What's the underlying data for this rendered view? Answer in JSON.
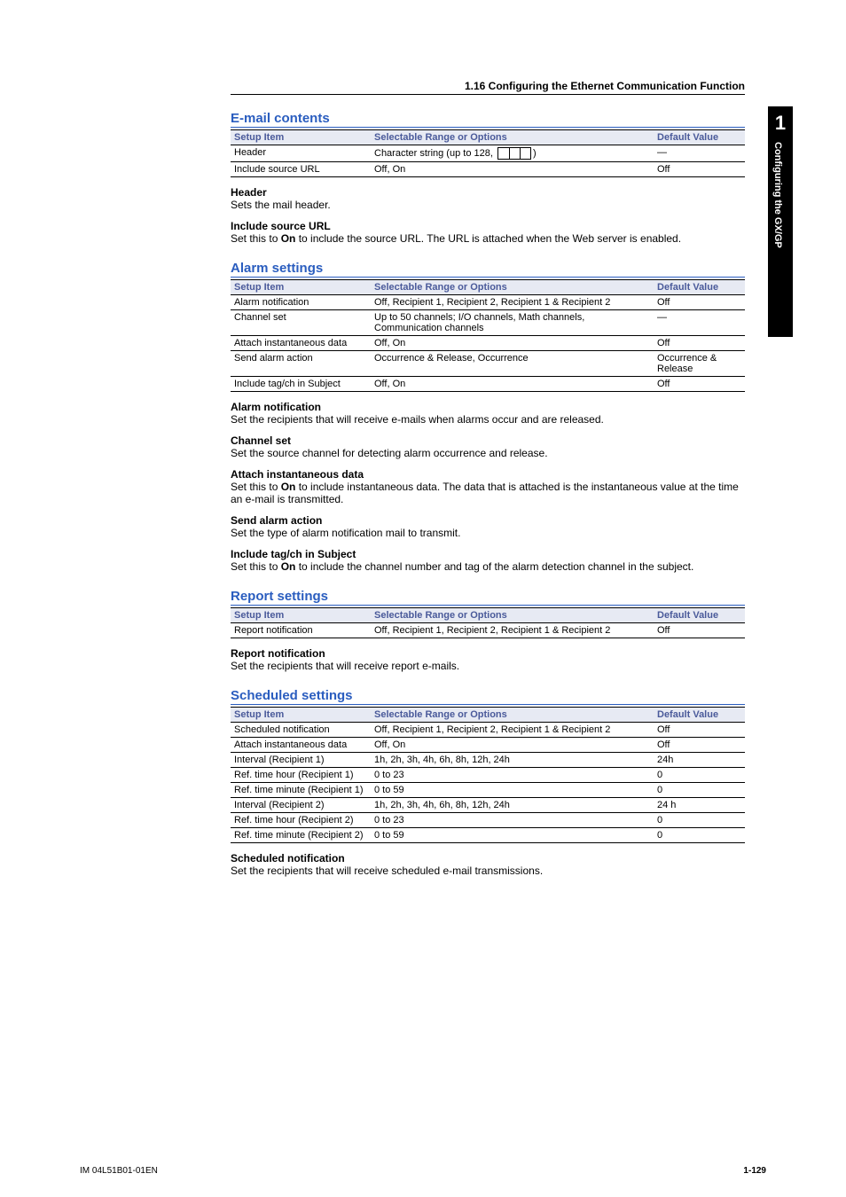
{
  "breadcrumb": "1.16  Configuring the Ethernet Communication Function",
  "sideTab": {
    "num": "1",
    "label": "Configuring the GX/GP"
  },
  "footer": {
    "left": "IM 04L51B01-01EN",
    "right": "1-129"
  },
  "email": {
    "title": "E-mail contents",
    "table": {
      "h1": "Setup Item",
      "h2": "Selectable Range or Options",
      "h3": "Default Value",
      "rows": [
        {
          "c1": "Header",
          "c2_prefix": "Character string (up to 128, ",
          "c2_suffix": ")",
          "c3": "―",
          "hasBox": true
        },
        {
          "c1": "Include source URL",
          "c2": "Off, On",
          "c3": "Off"
        }
      ]
    },
    "desc": [
      {
        "head": "Header",
        "body": "Sets the mail header."
      },
      {
        "head": "Include source URL",
        "body_pre": "Set this to ",
        "body_bold": "On",
        "body_post": " to include the source URL. The URL is attached when the Web server is enabled."
      }
    ]
  },
  "alarm": {
    "title": "Alarm settings",
    "table": {
      "h1": "Setup Item",
      "h2": "Selectable Range or Options",
      "h3": "Default Value",
      "rows": [
        {
          "c1": "Alarm notification",
          "c2": "Off, Recipient 1, Recipient 2, Recipient 1 & Recipient 2",
          "c3": "Off"
        },
        {
          "c1": "Channel set",
          "c2": "Up to 50 channels; I/O channels, Math channels, Communication channels",
          "c3": "―"
        },
        {
          "c1": "Attach instantaneous data",
          "c2": "Off, On",
          "c3": "Off"
        },
        {
          "c1": "Send alarm action",
          "c2": "Occurrence & Release, Occurrence",
          "c3": "Occurrence & Release"
        },
        {
          "c1": "Include tag/ch in Subject",
          "c2": "Off, On",
          "c3": "Off"
        }
      ]
    },
    "desc": [
      {
        "head": "Alarm notification",
        "body": "Set the recipients that will receive e-mails when alarms occur and are released."
      },
      {
        "head": "Channel set",
        "body": "Set the source channel for detecting alarm occurrence and release."
      },
      {
        "head": "Attach instantaneous data",
        "body_pre": "Set this to ",
        "body_bold": "On",
        "body_post": " to include instantaneous data. The data that is attached is the instantaneous value at the time an e-mail is transmitted."
      },
      {
        "head": "Send alarm action",
        "body": "Set the type of alarm notification mail to transmit."
      },
      {
        "head": "Include tag/ch in Subject",
        "body_pre": "Set this to ",
        "body_bold": "On",
        "body_post": " to include the channel number and tag of the alarm detection channel in the subject."
      }
    ]
  },
  "report": {
    "title": "Report settings",
    "table": {
      "h1": "Setup Item",
      "h2": "Selectable Range or Options",
      "h3": "Default Value",
      "rows": [
        {
          "c1": "Report notification",
          "c2": "Off, Recipient 1, Recipient 2, Recipient 1 & Recipient 2",
          "c3": "Off"
        }
      ]
    },
    "desc": [
      {
        "head": "Report notification",
        "body": "Set the recipients that will receive report e-mails."
      }
    ]
  },
  "scheduled": {
    "title": "Scheduled settings",
    "table": {
      "h1": "Setup Item",
      "h2": "Selectable Range or Options",
      "h3": "Default Value",
      "rows": [
        {
          "c1": "Scheduled notification",
          "c2": "Off, Recipient 1, Recipient 2, Recipient 1 & Recipient 2",
          "c3": "Off"
        },
        {
          "c1": "Attach instantaneous data",
          "c2": "Off, On",
          "c3": "Off"
        },
        {
          "c1": "Interval (Recipient 1)",
          "c2": "1h, 2h, 3h, 4h, 6h, 8h, 12h, 24h",
          "c3": "24h"
        },
        {
          "c1": "Ref. time hour (Recipient 1)",
          "c2": "0 to 23",
          "c3": "0"
        },
        {
          "c1": "Ref. time minute (Recipient 1)",
          "c2": "0 to 59",
          "c3": "0"
        },
        {
          "c1": "Interval (Recipient 2)",
          "c2": "1h, 2h, 3h, 4h, 6h, 8h, 12h, 24h",
          "c3": "24 h"
        },
        {
          "c1": "Ref. time hour (Recipient 2)",
          "c2": "0 to 23",
          "c3": "0"
        },
        {
          "c1": "Ref. time minute (Recipient 2)",
          "c2": "0 to 59",
          "c3": "0"
        }
      ]
    },
    "desc": [
      {
        "head": "Scheduled notification",
        "body": "Set the recipients that will receive scheduled e-mail transmissions."
      }
    ]
  }
}
